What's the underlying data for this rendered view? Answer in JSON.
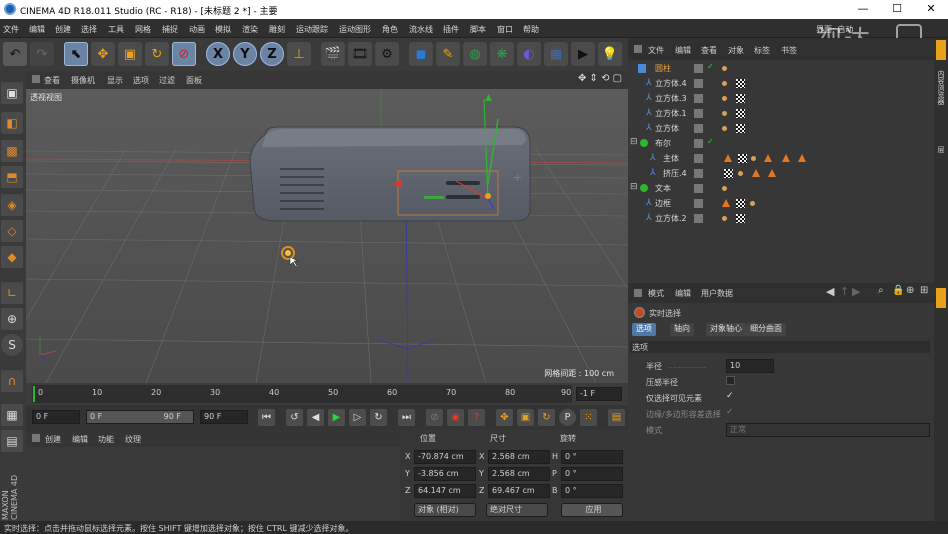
{
  "titlebar": {
    "title": "CINEMA 4D R18.011 Studio (RC - R18) - [未标题 2 *] - 主要",
    "minimize": "—",
    "maximize": "☐",
    "close": "✕"
  },
  "watermark": "视达",
  "menubar": {
    "items": [
      "文件",
      "编辑",
      "创建",
      "选择",
      "工具",
      "网格",
      "捕捉",
      "动画",
      "模拟",
      "渲染",
      "雕刻",
      "运动跟踪",
      "运动图形",
      "角色",
      "流水线",
      "插件",
      "脚本",
      "窗口",
      "帮助"
    ],
    "right": "界面: 启动"
  },
  "toolbar": {
    "icons": [
      "undo-icon",
      "redo-icon",
      "select-icon",
      "move-icon",
      "scale-icon",
      "rotate-icon",
      "live-select-icon",
      "x-axis-icon",
      "y-axis-icon",
      "z-axis-icon",
      "coord-system-icon",
      "render-view-icon",
      "render-picture-icon",
      "render-settings-icon",
      "cube-icon",
      "pen-icon",
      "subdivision-icon",
      "cloner-icon",
      "deformer-icon",
      "floor-icon",
      "camera-icon",
      "light-icon"
    ],
    "xyz": [
      "X",
      "Y",
      "Z"
    ]
  },
  "viewport_menu": {
    "items": [
      "查看",
      "摄像机",
      "显示",
      "选项",
      "过滤",
      "面板"
    ]
  },
  "viewport": {
    "label": "透视视图",
    "grid": "网格间距 : 100 cm"
  },
  "timeline": {
    "ticks": [
      "0",
      "10",
      "20",
      "30",
      "40",
      "50",
      "60",
      "70",
      "80",
      "90"
    ],
    "end_field": "-1 F"
  },
  "transport": {
    "start": "0 F",
    "min": "0 F",
    "max": "90 F",
    "end": "90 F"
  },
  "material_menu": {
    "items": [
      "创建",
      "编辑",
      "功能",
      "纹理"
    ]
  },
  "coords": {
    "headers": [
      "位置",
      "尺寸",
      "旋转"
    ],
    "rows": [
      {
        "axis": "X",
        "pos": "-70.874 cm",
        "saxis": "X",
        "size": "2.568 cm",
        "raxis": "H",
        "rot": "0 °"
      },
      {
        "axis": "Y",
        "pos": "-3.856 cm",
        "saxis": "Y",
        "size": "2.568 cm",
        "raxis": "P",
        "rot": "0 °"
      },
      {
        "axis": "Z",
        "pos": "64.147 cm",
        "saxis": "Z",
        "size": "69.467 cm",
        "raxis": "B",
        "rot": "0 °"
      }
    ],
    "mode1": "对象 (相对)",
    "mode2": "绝对尺寸",
    "apply": "应用"
  },
  "object_menu": {
    "items": [
      "文件",
      "编辑",
      "查看",
      "对象",
      "标签",
      "书签"
    ]
  },
  "objects": [
    {
      "name": "圆柱",
      "indent": 0,
      "sel": true
    },
    {
      "name": "立方体.4",
      "indent": 0
    },
    {
      "name": "立方体.3",
      "indent": 0
    },
    {
      "name": "立方体.1",
      "indent": 0
    },
    {
      "name": "立方体",
      "indent": 0
    },
    {
      "name": "布尔",
      "indent": 0,
      "group": true
    },
    {
      "name": "主体",
      "indent": 1
    },
    {
      "name": "挤压.4",
      "indent": 1
    },
    {
      "name": "文本",
      "indent": 0,
      "group": true
    },
    {
      "name": "边框",
      "indent": 0
    },
    {
      "name": "立方体.2",
      "indent": 0
    }
  ],
  "attr_menu": {
    "items": [
      "模式",
      "编辑",
      "用户数据"
    ]
  },
  "attr": {
    "tool": "实时选择",
    "tabs": [
      "选项",
      "轴向",
      "对象轴心",
      "细分曲面"
    ],
    "section": "选项",
    "radius_label": "半径",
    "radius_value": "10",
    "pressure_label": "压感半径",
    "visible_label": "仅选择可见元素",
    "poly_label": "边缘/多边形容差选择",
    "mode_label": "模式",
    "mode_value": "正常"
  },
  "status": "实时选择：点击并拖动鼠标选择元素。按住 SHIFT 键增加选择对象；按住 CTRL 键减少选择对象。",
  "rightstrip": [
    "对象",
    "内容浏览器",
    "构造",
    "层"
  ],
  "maxon": "MAXON CINEMA 4D"
}
